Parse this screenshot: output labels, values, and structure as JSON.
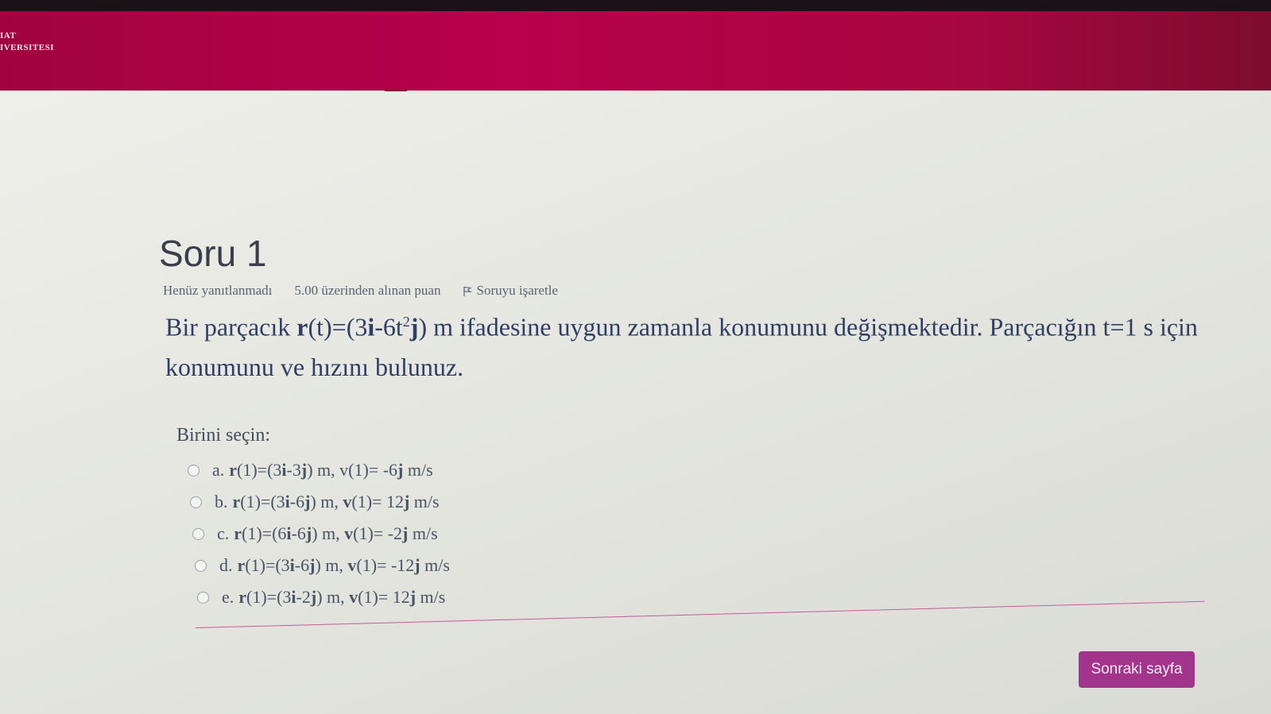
{
  "header": {
    "logo_line1": "IAT",
    "logo_line2": "IVERSITESI"
  },
  "question": {
    "title": "Soru 1",
    "status": "Henüz yanıtlanmadı",
    "points": "5.00 üzerinden alınan puan",
    "flag_label": "Soruyu işaretle",
    "flag_icon": "flag-icon",
    "text_part1": "Bir parçacık ",
    "text_r": "r",
    "text_part2": "(t)=(3",
    "text_i": "i",
    "text_part3": "-6t",
    "text_sup": "2",
    "text_j": "j",
    "text_part4": ") m ifadesine uygun zamanla konumunu değişmektedir. Parçacığın t=1 s için konumunu ve hızını bulunuz."
  },
  "choose_label": "Birini seçin:",
  "options": [
    {
      "letter": "a.",
      "r": "r",
      "r_val": "(1)=(3",
      "i": "i",
      "mid": "-3",
      "j": "j",
      "rest": ") m, ",
      "v": "v",
      "v_val": "(1)= -6",
      "vj": "j",
      "unit": " m/s"
    },
    {
      "letter": "b.",
      "r": "r",
      "r_val": "(1)=(3",
      "i": "i",
      "mid": "-6",
      "j": "j",
      "rest": ") m, ",
      "v": "v",
      "v_val": "(1)= 12",
      "vj": "j",
      "unit": " m/s"
    },
    {
      "letter": "c.",
      "r": "r",
      "r_val": "(1)=(6",
      "i": "i",
      "mid": "-6",
      "j": "j",
      "rest": ") m, ",
      "v": "v",
      "v_val": "(1)= -2",
      "vj": "j",
      "unit": " m/s"
    },
    {
      "letter": "d.",
      "r": "r",
      "r_val": "(1)=(3",
      "i": "i",
      "mid": "-6",
      "j": "j",
      "rest": ") m, ",
      "v": "v",
      "v_val": "(1)= -12",
      "vj": "j",
      "unit": " m/s"
    },
    {
      "letter": "e.",
      "r": "r",
      "r_val": "(1)=(3",
      "i": "i",
      "mid": "-2",
      "j": "j",
      "rest": ") m, ",
      "v": "v",
      "v_val": "(1)= 12",
      "vj": "j",
      "unit": " m/s"
    }
  ],
  "next_button": "Sonraki sayfa",
  "colors": {
    "header": "#b8004d",
    "button": "#a3348c",
    "question_text": "#2f3e64"
  }
}
